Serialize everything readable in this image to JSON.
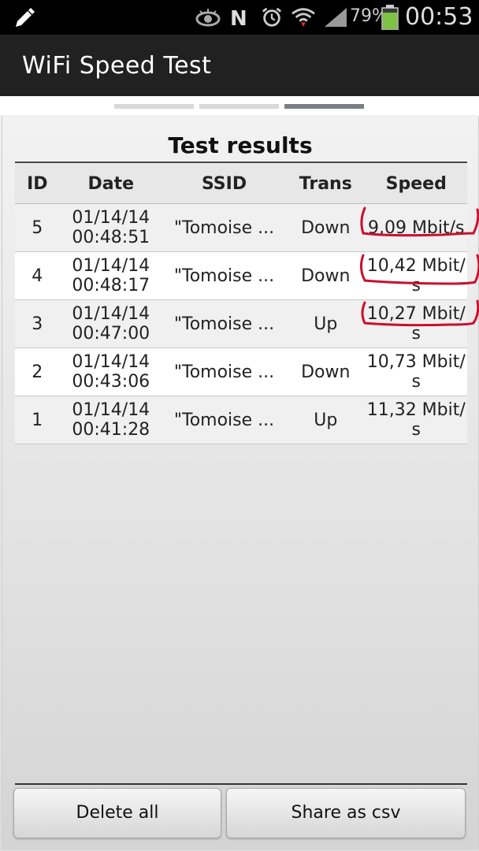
{
  "status_bar": {
    "battery_percent": "79%",
    "time": "00:53",
    "icons": [
      "edit-icon",
      "eye-icon",
      "n-icon",
      "alarm-icon",
      "wifi-icon",
      "signal-icon",
      "battery-icon"
    ]
  },
  "app": {
    "title": "WiFi Speed Test"
  },
  "tabs": {
    "count": 3,
    "active_index": 2
  },
  "results": {
    "title": "Test results",
    "columns": [
      "ID",
      "Date",
      "SSID",
      "Trans",
      "Speed"
    ],
    "rows": [
      {
        "id": "5",
        "date_line1": "01/14/14",
        "date_line2": "00:48:51",
        "ssid": "\"Tomoise ...",
        "trans": "Down",
        "speed_line1": "9,09 Mbit/s",
        "speed_line2": ""
      },
      {
        "id": "4",
        "date_line1": "01/14/14",
        "date_line2": "00:48:17",
        "ssid": "\"Tomoise ...",
        "trans": "Down",
        "speed_line1": "10,42 Mbit/",
        "speed_line2": "s"
      },
      {
        "id": "3",
        "date_line1": "01/14/14",
        "date_line2": "00:47:00",
        "ssid": "\"Tomoise ...",
        "trans": "Up",
        "speed_line1": "10,27 Mbit/",
        "speed_line2": "s"
      },
      {
        "id": "2",
        "date_line1": "01/14/14",
        "date_line2": "00:43:06",
        "ssid": "\"Tomoise ...",
        "trans": "Down",
        "speed_line1": "10,73 Mbit/",
        "speed_line2": "s"
      },
      {
        "id": "1",
        "date_line1": "01/14/14",
        "date_line2": "00:41:28",
        "ssid": "\"Tomoise ...",
        "trans": "Up",
        "speed_line1": "11,32 Mbit/",
        "speed_line2": "s"
      }
    ]
  },
  "buttons": {
    "delete_all": "Delete all",
    "share_csv": "Share as csv"
  },
  "colors": {
    "annotation": "#c8102e",
    "active_tab": "#7b7f85",
    "action_bar": "#212121"
  }
}
